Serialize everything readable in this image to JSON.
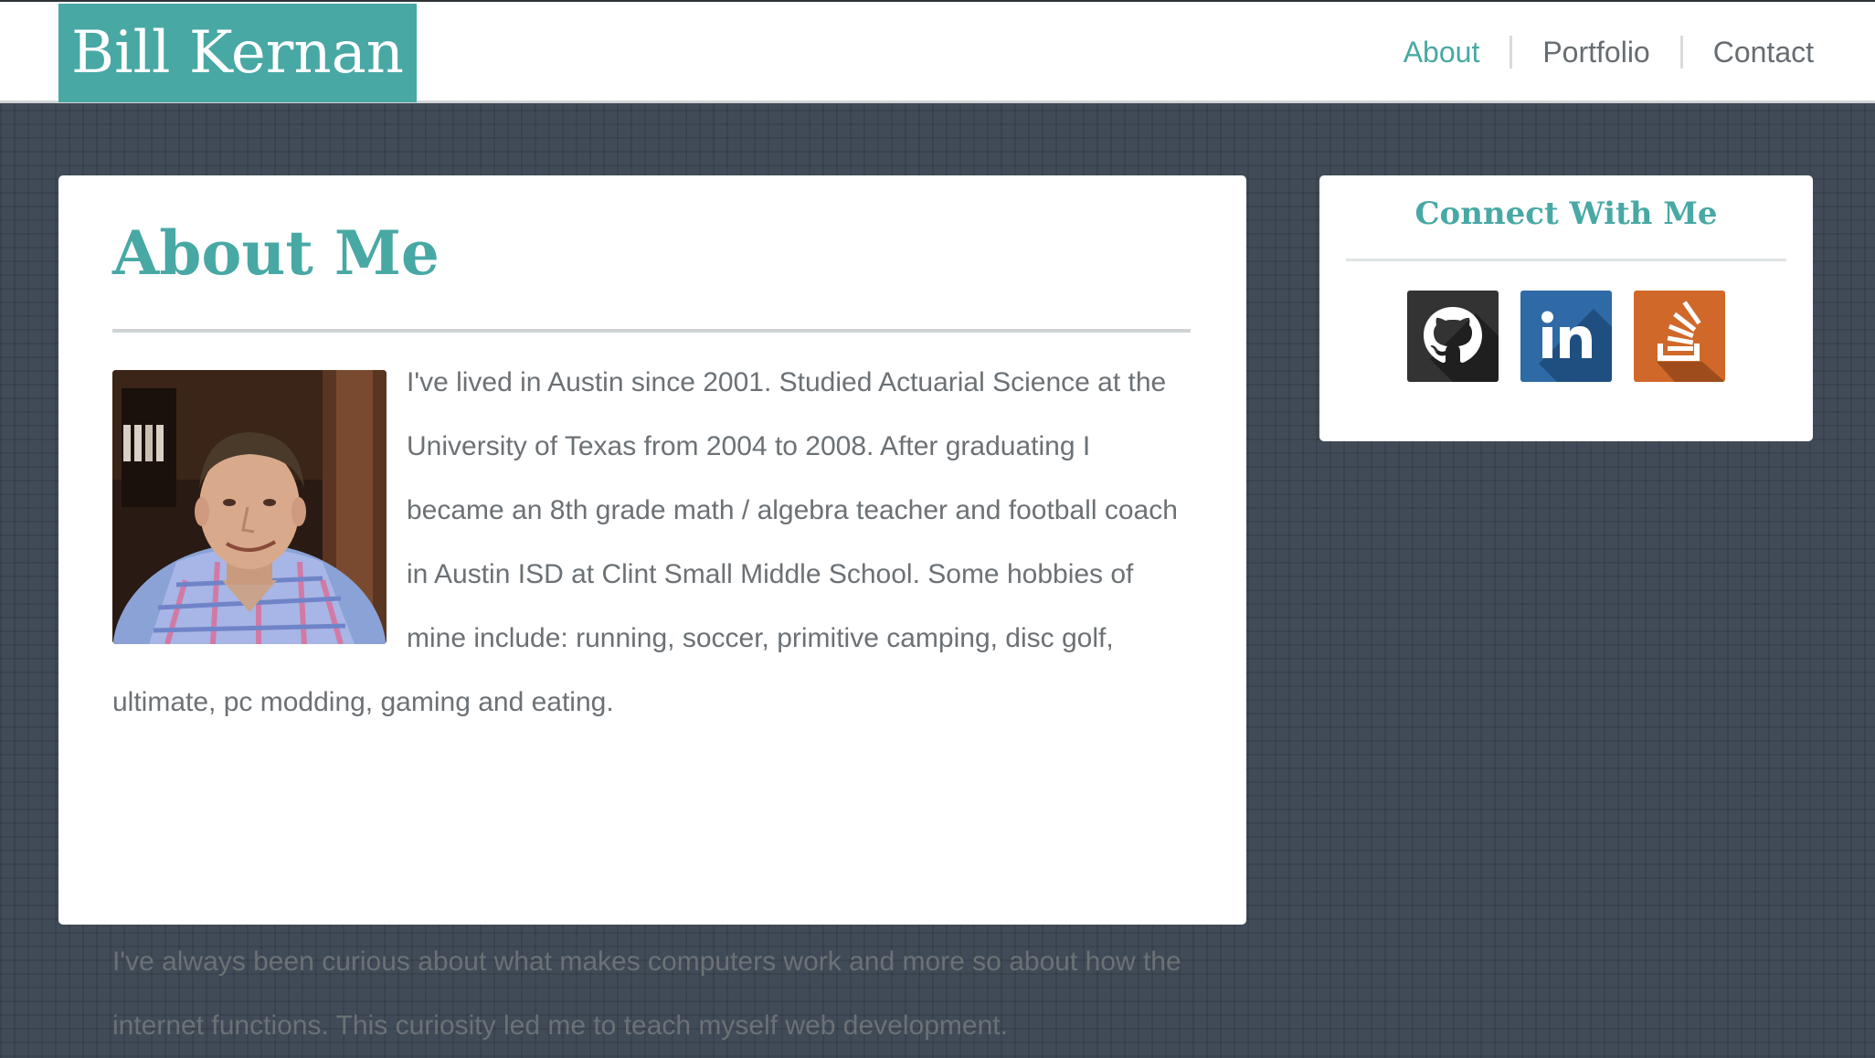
{
  "header": {
    "brand": "Bill Kernan",
    "nav": [
      {
        "label": "About",
        "active": true
      },
      {
        "label": "Portfolio",
        "active": false
      },
      {
        "label": "Contact",
        "active": false
      }
    ]
  },
  "about": {
    "title": "About Me",
    "paragraph1": "I've lived in Austin since 2001. Studied Actuarial Science at the University of Texas from 2004 to 2008. After graduating I became an 8th grade math / algebra teacher and football coach in Austin ISD at Clint Small Middle School. Some hobbies of mine include: running, soccer, primitive camping, disc golf, ultimate, pc modding, gaming and eating.",
    "paragraph2": "I've always been curious about what makes computers work and more so about how the internet functions. This curiosity led me to teach myself web development."
  },
  "sidebar": {
    "title": "Connect With Me",
    "social": [
      {
        "icon": "github-icon",
        "color": "#333333"
      },
      {
        "icon": "linkedin-icon",
        "color": "#2f6aa6"
      },
      {
        "icon": "stackoverflow-icon",
        "color": "#d0682a"
      }
    ]
  },
  "colors": {
    "accent": "#48a8a4",
    "background": "#414b57",
    "text": "#6b7175"
  }
}
